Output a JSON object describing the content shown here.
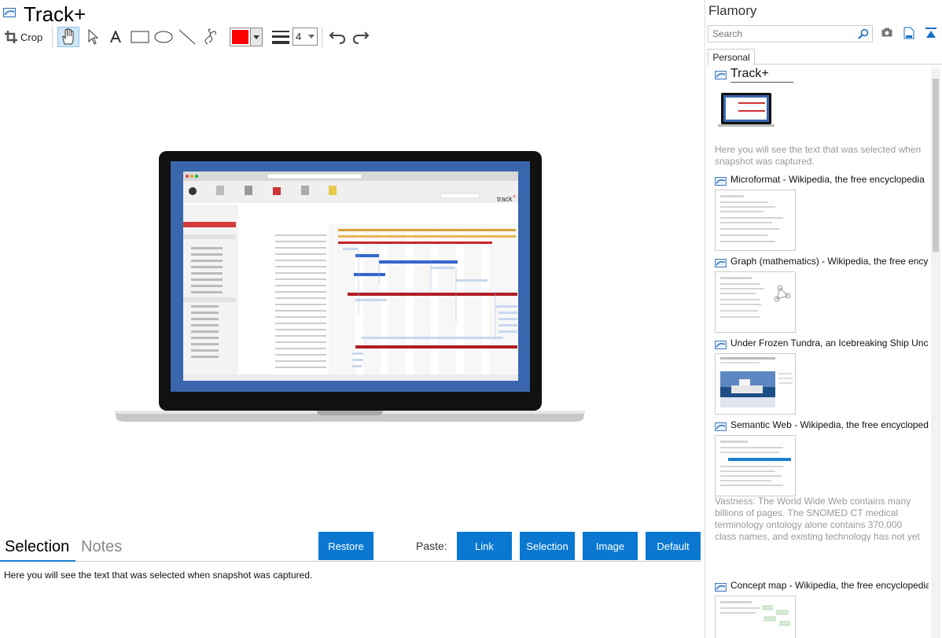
{
  "window": {
    "title": "Track+"
  },
  "toolbar": {
    "crop_label": "Crop",
    "color": "#ff0000",
    "stroke_width": "4",
    "tools": [
      "hand-icon",
      "pointer-icon",
      "text-icon",
      "rectangle-icon",
      "ellipse-icon",
      "line-icon",
      "freehand-icon",
      "line-width-icon",
      "undo-icon",
      "redo-icon"
    ]
  },
  "stage": {
    "image": "laptop screenshot of Track+ Gantt view"
  },
  "bottom": {
    "tabs": [
      "Selection",
      "Notes"
    ],
    "restore_label": "Restore",
    "paste_label": "Paste:",
    "link_label": "Link",
    "selection_label": "Selection",
    "image_label": "Image",
    "default_label": "Default",
    "selection_text": "Here you will see the text that was selected when snapshot was captured."
  },
  "sidebar": {
    "brand": "Flamory",
    "search_placeholder": "Search",
    "tab_personal": "Personal",
    "items": [
      {
        "title": "Track+",
        "desc": "Here you will see the text that was selected when snapshot was captured."
      },
      {
        "title": "Microformat - Wikipedia, the free encyclopedia"
      },
      {
        "title": "Graph (mathematics) - Wikipedia, the free encyclopedia"
      },
      {
        "title": "Under Frozen Tundra, an Icebreaking Ship Uncovers"
      },
      {
        "title": "Semantic Web - Wikipedia, the free encyclopedia",
        "desc": "Vastness: The World Wide Web contains many billions of pages. The SNOMED CT medical terminology ontology alone contains 370,000 class names, and existing technology has not yet been able to eliminate all semantically duplicated terms. Any automated reasoning system will have to deal with truly huge inputs."
      },
      {
        "title": "Concept map - Wikipedia, the free encyclopedia"
      }
    ]
  },
  "colors": {
    "accent": "#0a78d1",
    "track_logo": "#e31b23"
  }
}
